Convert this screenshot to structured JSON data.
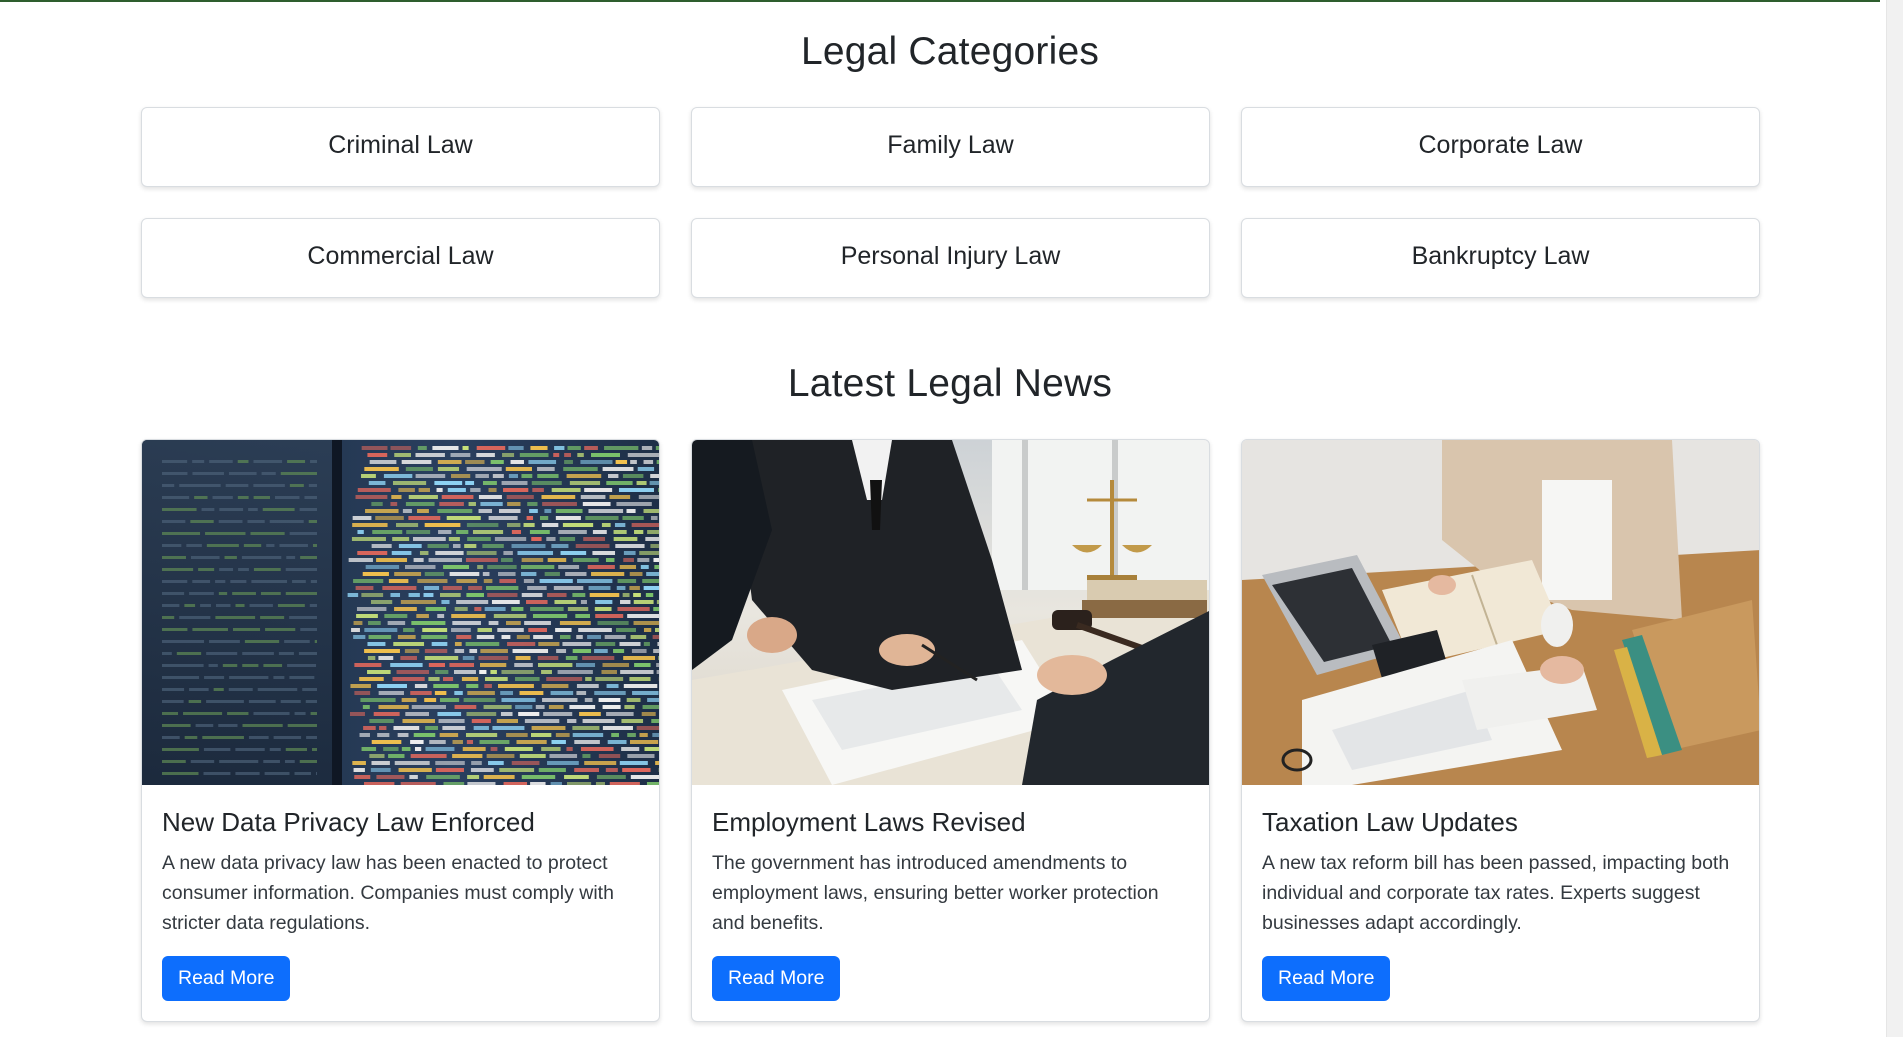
{
  "sections": {
    "categories_title": "Legal Categories",
    "news_title": "Latest Legal News"
  },
  "categories": [
    {
      "label": "Criminal Law"
    },
    {
      "label": "Family Law"
    },
    {
      "label": "Corporate Law"
    },
    {
      "label": "Commercial Law"
    },
    {
      "label": "Personal Injury Law"
    },
    {
      "label": "Bankruptcy Law"
    }
  ],
  "news": [
    {
      "image": "code-screen-photo",
      "title": "New Data Privacy Law Enforced",
      "text": "A new data privacy law has been enacted to protect consumer information. Companies must comply with stricter data regulations.",
      "button": "Read More"
    },
    {
      "image": "business-meeting-photo",
      "title": "Employment Laws Revised",
      "text": "The government has introduced amendments to employment laws, ensuring better worker protection and benefits.",
      "button": "Read More"
    },
    {
      "image": "tax-paperwork-photo",
      "title": "Taxation Law Updates",
      "text": "A new tax reform bill has been passed, impacting both individual and corporate tax rates. Experts suggest businesses adapt accordingly.",
      "button": "Read More"
    }
  ],
  "colors": {
    "primary_button": "#0d6efd",
    "top_border": "#2e5e2e",
    "text": "#212529"
  }
}
